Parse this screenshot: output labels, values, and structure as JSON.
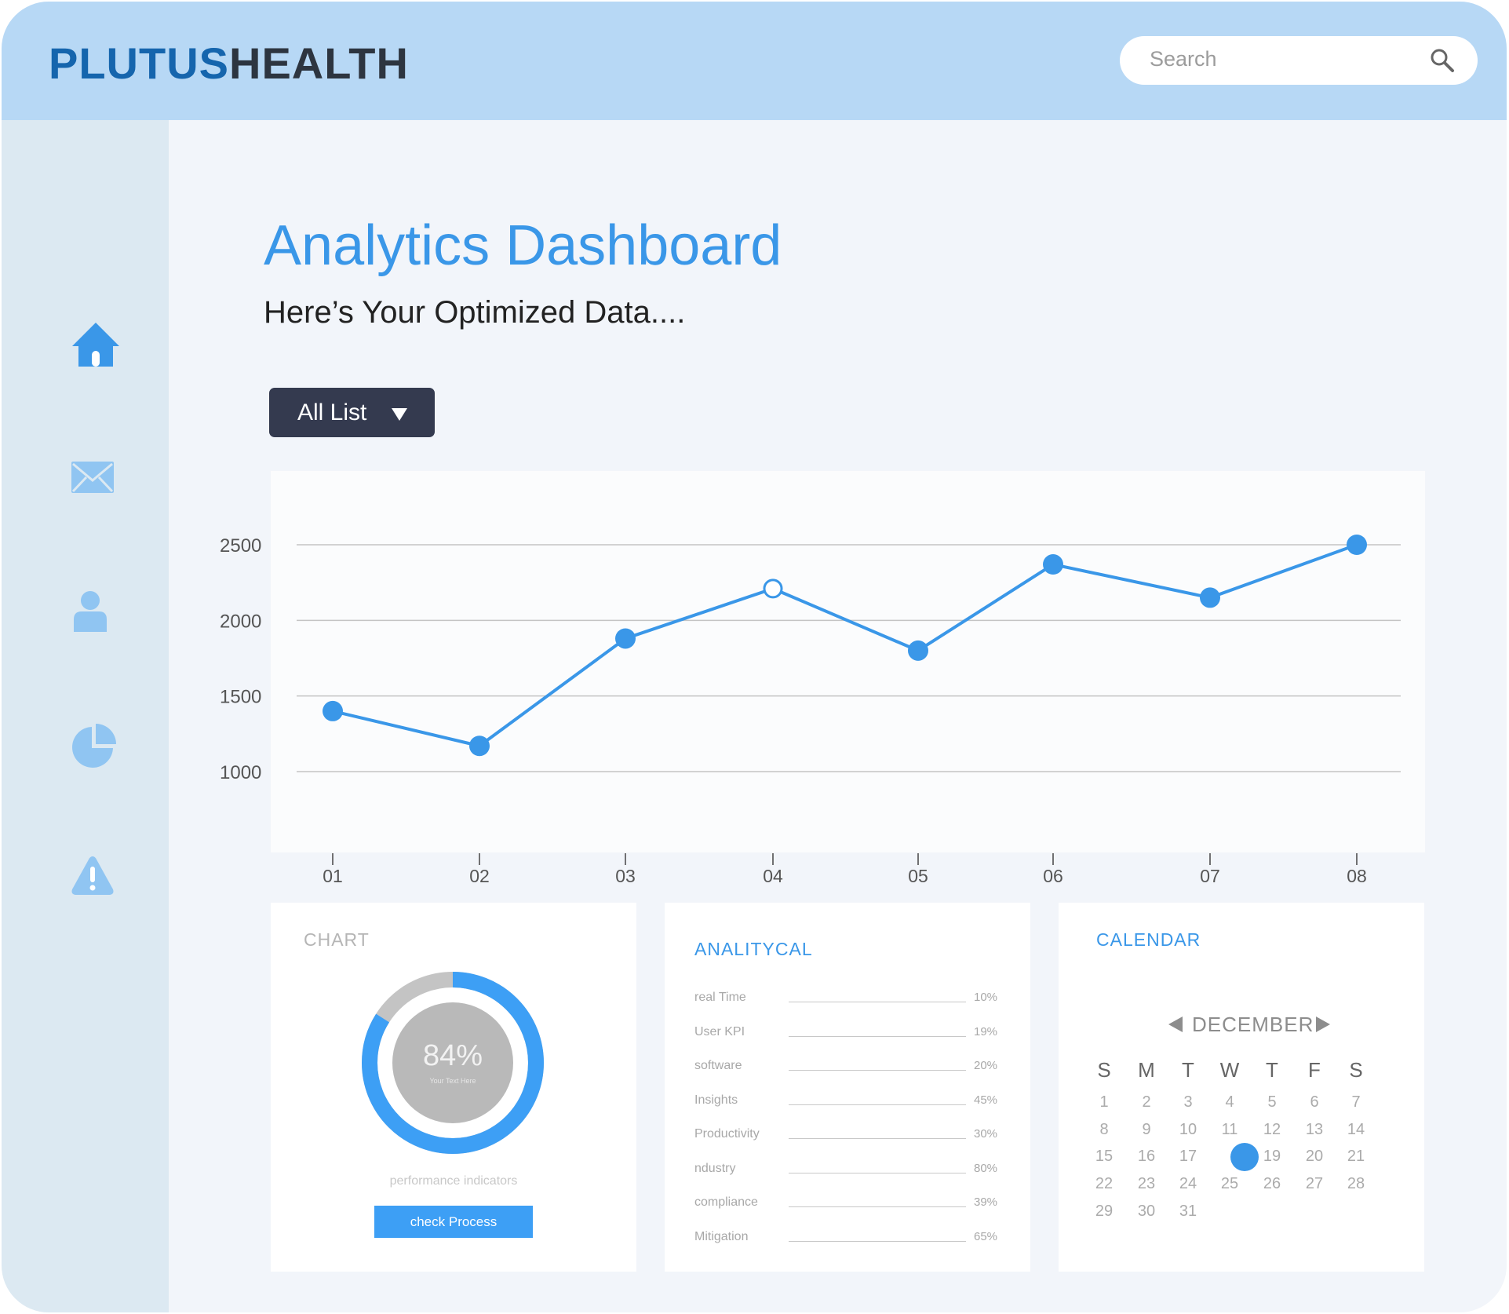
{
  "brand": {
    "part1": "PLUTUS",
    "part2": "HEALTH"
  },
  "search": {
    "placeholder": "Search"
  },
  "sidebar": {
    "items": [
      {
        "name": "home",
        "icon": "home-icon",
        "active": true
      },
      {
        "name": "mail",
        "icon": "mail-icon"
      },
      {
        "name": "profile",
        "icon": "user-icon"
      },
      {
        "name": "reports",
        "icon": "pie-chart-icon"
      },
      {
        "name": "alerts",
        "icon": "warning-icon"
      }
    ]
  },
  "header": {
    "title": "Analytics Dashboard",
    "subtitle": "Here’s Your Optimized Data...."
  },
  "filter": {
    "label": "All List"
  },
  "chart_data": {
    "type": "line",
    "x": [
      "01",
      "02",
      "03",
      "04",
      "05",
      "06",
      "07",
      "08"
    ],
    "series": [
      {
        "values": [
          1400,
          1170,
          1880,
          2210,
          1800,
          2370,
          2150,
          2500
        ]
      }
    ],
    "yticks": [
      "1000",
      "1500",
      "2000",
      "2500"
    ],
    "ylim": [
      1000,
      2500
    ],
    "highlighted_point": 3,
    "grid": true,
    "color": "#3a97e8"
  },
  "cards": {
    "chart": {
      "title": "CHART",
      "value": "84%",
      "percent": 84,
      "value_caption": "Your Text Here",
      "caption": "performance indicators",
      "button": "check Process"
    },
    "analytical": {
      "title": "ANALITYCAL",
      "rows": [
        {
          "label": "real Time",
          "value": "10%"
        },
        {
          "label": "User KPI",
          "value": "19%"
        },
        {
          "label": "software",
          "value": "20%"
        },
        {
          "label": "Insights",
          "value": "45%"
        },
        {
          "label": "Productivity",
          "value": "30%"
        },
        {
          "label": "ndustry",
          "value": "80%"
        },
        {
          "label": "compliance",
          "value": "39%"
        },
        {
          "label": "Mitigation",
          "value": "65%"
        }
      ]
    },
    "calendar": {
      "title": "CALENDAR",
      "month": "DECEMBER",
      "weekdays": [
        "S",
        "M",
        "T",
        "W",
        "T",
        "F",
        "S"
      ],
      "weeks": [
        [
          "1",
          "2",
          "3",
          "4",
          "5",
          "6",
          "7"
        ],
        [
          "8",
          "9",
          "10",
          "11",
          "12",
          "13",
          "14"
        ],
        [
          "15",
          "16",
          "17",
          "18",
          "19",
          "20",
          "21"
        ],
        [
          "22",
          "23",
          "24",
          "25",
          "26",
          "27",
          "28"
        ],
        [
          "29",
          "30",
          "31"
        ]
      ],
      "selected": "18"
    }
  },
  "colors": {
    "accent": "#3a97e8",
    "topbar": "#b7d8f5",
    "sidebar": "#dce9f2",
    "button_dark": "#343a4f"
  }
}
